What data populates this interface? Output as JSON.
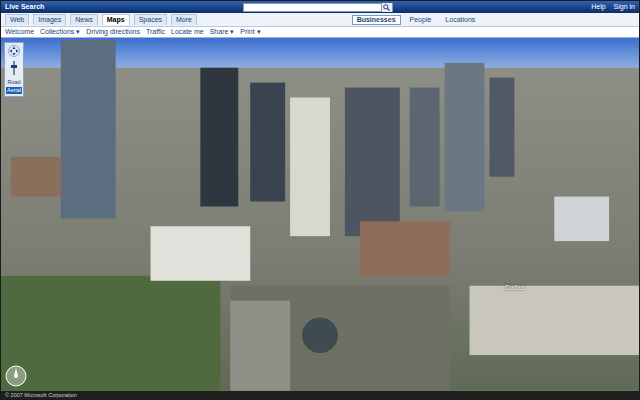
{
  "window": {
    "title": "Live Search",
    "links": [
      "Help",
      "Sign in"
    ]
  },
  "search": {
    "value": "",
    "buttons": [
      {
        "label": "Businesses",
        "selected": true
      },
      {
        "label": "People",
        "selected": false
      },
      {
        "label": "Locations",
        "selected": false
      }
    ]
  },
  "tabs": [
    {
      "label": "Web",
      "selected": false
    },
    {
      "label": "Images",
      "selected": false
    },
    {
      "label": "News",
      "selected": false
    },
    {
      "label": "Maps",
      "selected": true
    },
    {
      "label": "Spaces",
      "selected": false
    },
    {
      "label": "More",
      "selected": false
    }
  ],
  "toolbar": [
    "Welcome",
    "Collections ▾",
    "Driving directions",
    "Traffic",
    "Locate me",
    "Share ▾",
    "Print ▾"
  ],
  "map_controls": [
    {
      "label": "Road",
      "selected": false
    },
    {
      "label": "Aerial",
      "selected": true
    }
  ],
  "map_labels": [
    "Dallas"
  ],
  "status_bar": "© 2007 Microsoft Corporation"
}
